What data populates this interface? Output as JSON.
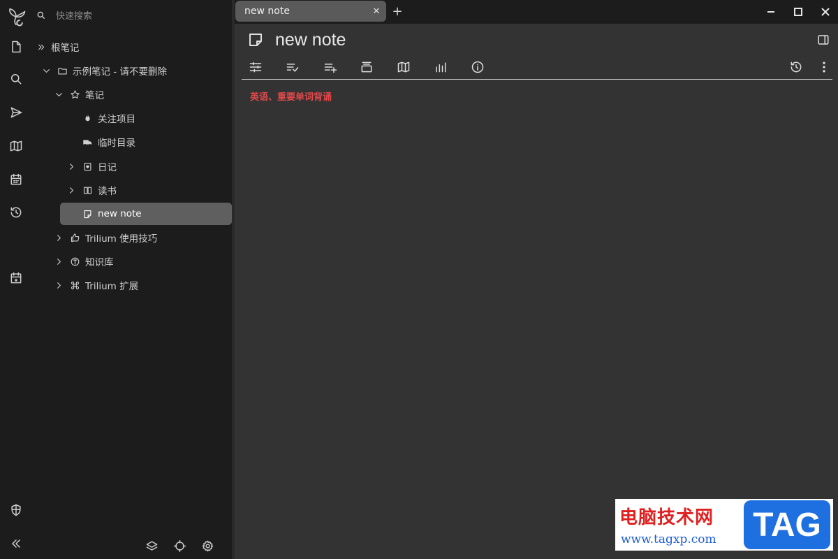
{
  "sidebar": {
    "search_placeholder": "快速搜索",
    "launchers": [
      {
        "icon": "trilium-logo-icon"
      },
      {
        "icon": "new-note-icon"
      },
      {
        "icon": "search-icon"
      },
      {
        "icon": "jump-to-icon"
      },
      {
        "icon": "note-map-icon"
      },
      {
        "icon": "calendar-icon"
      },
      {
        "icon": "recent-changes-icon"
      },
      {
        "icon": "today-icon"
      },
      {
        "icon": "protected-session-icon"
      },
      {
        "icon": "collapse-sidebar-icon"
      }
    ],
    "tree": [
      {
        "label": "根笔记",
        "icon": "root-icon"
      },
      {
        "label": "示例笔记 - 请不要删除",
        "icon": "folder-icon"
      },
      {
        "label": "笔记",
        "icon": "star-icon"
      },
      {
        "label": "关注项目",
        "icon": "fire-icon"
      },
      {
        "label": "临时目录",
        "icon": "ambulance-icon"
      },
      {
        "label": "日记",
        "icon": "calendar-heart-icon"
      },
      {
        "label": "读书",
        "icon": "book-icon"
      },
      {
        "label": "new note",
        "icon": "note-icon"
      },
      {
        "label": "Trilium 使用技巧",
        "icon": "thumbs-up-icon"
      },
      {
        "label": "知识库",
        "icon": "book-circle-icon"
      },
      {
        "label": "Trilium 扩展",
        "icon": "command-icon"
      }
    ]
  },
  "tabs": [
    {
      "label": "new note",
      "active": true
    }
  ],
  "note": {
    "title": "new note",
    "content": "英语、重要单词背诵",
    "content_color": "#e2484a"
  },
  "toolbar": {
    "buttons": [
      "owned-attributes-icon",
      "promoted-attributes-icon",
      "add-note-icon",
      "collapse-icon",
      "note-map-icon",
      "stats-icon",
      "info-icon",
      "history-icon",
      "more-icon"
    ]
  },
  "watermark": {
    "text": "电脑技术网",
    "url": "www.tagxp.com",
    "badge": "TAG"
  },
  "colors": {
    "accent_active": "#5f5f5f",
    "background": "#333333",
    "sidebar_bg": "#1c1c1c"
  }
}
